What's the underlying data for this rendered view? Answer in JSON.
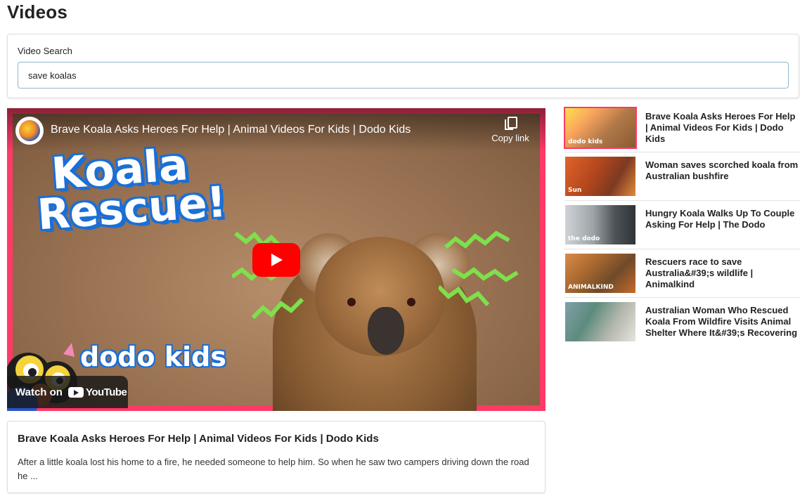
{
  "page": {
    "title": "Videos"
  },
  "search": {
    "label": "Video Search",
    "value": "save koalas"
  },
  "player": {
    "title": "Brave Koala Asks Heroes For Help | Animal Videos For Kids | Dodo Kids",
    "copy_link_label": "Copy link",
    "thumbnail_headline_1": "Koala",
    "thumbnail_headline_2": "Rescue!",
    "channel_logo_text": "dodo kids",
    "watch_on_label": "Watch on",
    "youtube_wordmark": "YouTube",
    "accent_color": "#ff3a66",
    "play_color": "#ff0000"
  },
  "description": {
    "title": "Brave Koala Asks Heroes For Help | Animal Videos For Kids | Dodo Kids",
    "text": "After a little koala lost his home to a fire, he needed someone to help him. So when he saw two campers driving down the road he ..."
  },
  "results": [
    {
      "title": "Brave Koala Asks Heroes For Help | Animal Videos For Kids | Dodo Kids",
      "badge": "dodo kids",
      "active": true
    },
    {
      "title": "Woman saves scorched koala from Australian bushfire",
      "badge": "Sun"
    },
    {
      "title": "Hungry Koala Walks Up To Couple Asking For Help | The Dodo",
      "badge": "the dodo"
    },
    {
      "title": "Rescuers race to save Australia&#39;s wildlife | Animalkind",
      "badge": "ANIMALKIND"
    },
    {
      "title": "Australian Woman Who Rescued Koala From Wildfire Visits Animal Shelter Where It&#39;s Recovering",
      "badge": ""
    }
  ]
}
